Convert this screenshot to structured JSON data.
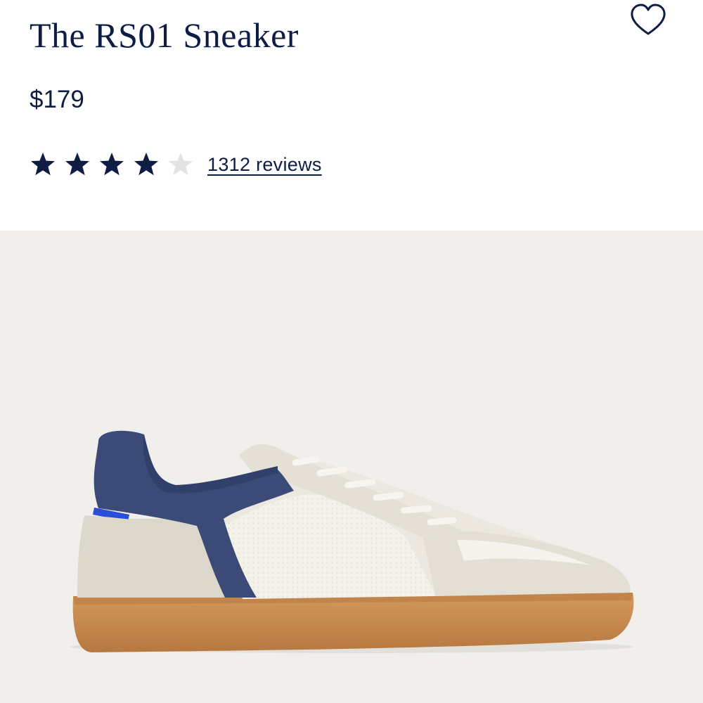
{
  "product": {
    "title": "The RS01 Sneaker",
    "price": "$179",
    "rating": {
      "value": 4,
      "max": 5,
      "reviews_label": "1312 reviews",
      "filled_color": "#0f1d45",
      "empty_color": "#e3e3e6"
    },
    "wishlist_icon": "heart-outline-icon",
    "image": {
      "subject": "sneaker",
      "colors": {
        "background": "#f0efeb",
        "upper": "#e8e4da",
        "heel_collar": "#3c4a78",
        "sole": "#c88a4f",
        "accent_tab": "#2a4ed8"
      }
    }
  }
}
